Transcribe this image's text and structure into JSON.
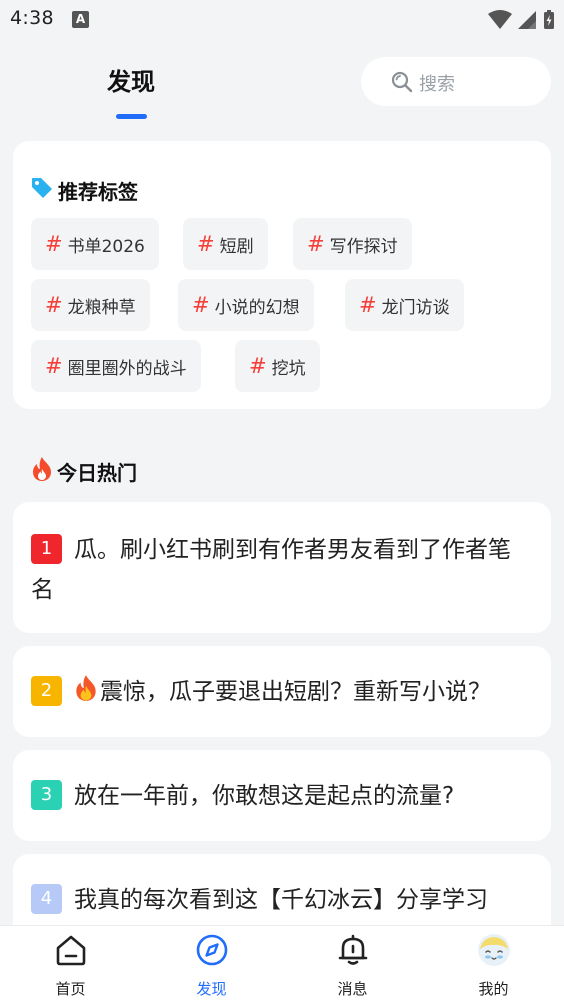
{
  "status_bar": {
    "time": "4:38",
    "notification_letter": "A"
  },
  "header": {
    "title": "发现",
    "search_placeholder": "搜索"
  },
  "tags": {
    "heading": "推荐标签",
    "hash_symbol": "#",
    "items": [
      "书单2026",
      "短剧",
      "写作探讨",
      "龙粮种草",
      "小说的幻想",
      "龙门访谈",
      "圈里圈外的战斗",
      "挖坑"
    ]
  },
  "hot": {
    "heading": "今日热门",
    "items": [
      {
        "rank": "1",
        "text": "瓜。刷小红书刷到有作者男友看到了作者笔名",
        "rank_color": "#f0262d",
        "has_fire": false
      },
      {
        "rank": "2",
        "text": "震惊，瓜子要退出短剧？重新写小说？",
        "rank_color": "#f7b500",
        "has_fire": true
      },
      {
        "rank": "3",
        "text": "放在一年前，你敢想这是起点的流量?",
        "rank_color": "#2ad1b2",
        "has_fire": false
      },
      {
        "rank": "4",
        "text": "我真的每次看到这【千幻冰云】分享学习",
        "rank_color": "#b6c9f7",
        "has_fire": false
      }
    ]
  },
  "bottom_nav": {
    "items": [
      {
        "label": "首页",
        "icon": "home-icon",
        "active": false
      },
      {
        "label": "发现",
        "icon": "compass-icon",
        "active": true
      },
      {
        "label": "消息",
        "icon": "bell-icon",
        "active": false
      },
      {
        "label": "我的",
        "icon": "avatar",
        "active": false
      }
    ]
  },
  "colors": {
    "accent": "#1f6dfa",
    "tag_hash": "#f5403a",
    "background": "#f3f4f6"
  }
}
